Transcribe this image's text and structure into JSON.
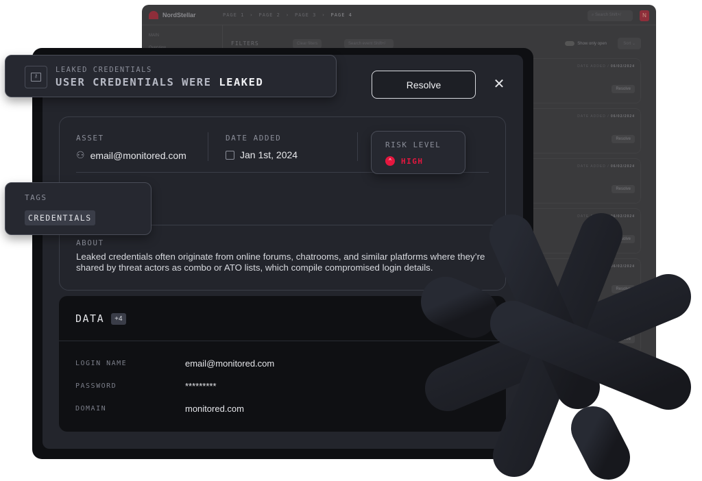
{
  "background_app": {
    "brand": "NordStellar",
    "breadcrumbs": [
      "PAGE 1",
      "PAGE 2",
      "PAGE 3",
      "PAGE 4"
    ],
    "search_placeholder": "Search",
    "search_shortcut": "Shift+/",
    "avatar_letter": "N",
    "sidebar_section": "MAIN",
    "sidebar_item": "Overview",
    "filters_label": "FILTERS",
    "clear_filters": "Clear filters",
    "search_event_placeholder": "Search event",
    "search_event_shortcut": "Shift+/",
    "show_only_open": "Show only open",
    "sort_label": "Sort",
    "events": [
      {
        "date_label": "DATE ADDED /",
        "date": "06/02/2024",
        "action": "Resolve"
      },
      {
        "date_label": "DATE ADDED /",
        "date": "06/02/2024",
        "action": "Resolve"
      },
      {
        "date_label": "DATE ADDED /",
        "date": "06/02/2024",
        "action": "Resolve"
      },
      {
        "date_label": "DATE ADDED /",
        "date": "06/02/2024",
        "action": "Resolve"
      },
      {
        "date_label": "DATE ADDED /",
        "date": "06/02/2024",
        "action": "Resolve"
      },
      {
        "date_label": "DATE ADDED /",
        "date": "06/02/2024",
        "action": "Resolve"
      }
    ]
  },
  "header": {
    "category": "LEAKED CREDENTIALS",
    "title_prefix": "USER CREDENTIALS WERE",
    "title_emphasis": "LEAKED",
    "icon": "key-icon"
  },
  "actions": {
    "resolve": "Resolve",
    "close": "✕"
  },
  "details": {
    "asset_label": "ASSET",
    "asset_value": "email@monitored.com",
    "date_label": "DATE ADDED",
    "date_value": "Jan 1st, 2024",
    "risk_label": "RISK LEVEL",
    "risk_value": "HIGH",
    "risk_color": "#e5173f",
    "tags_label": "TAGS",
    "tags": [
      "CREDENTIALS"
    ],
    "about_label": "ABOUT",
    "about_text": "Leaked credentials often originate from online forums, chatrooms, and similar platforms where they’re shared by threat actors as combo or ATO lists, which compile compromised login details."
  },
  "data_section": {
    "title": "DATA",
    "count_badge": "+4",
    "rows": [
      {
        "key": "LOGIN NAME",
        "value": "email@monitored.com"
      },
      {
        "key": "PASSWORD",
        "value": "*********"
      },
      {
        "key": "DOMAIN",
        "value": "monitored.com"
      }
    ]
  }
}
